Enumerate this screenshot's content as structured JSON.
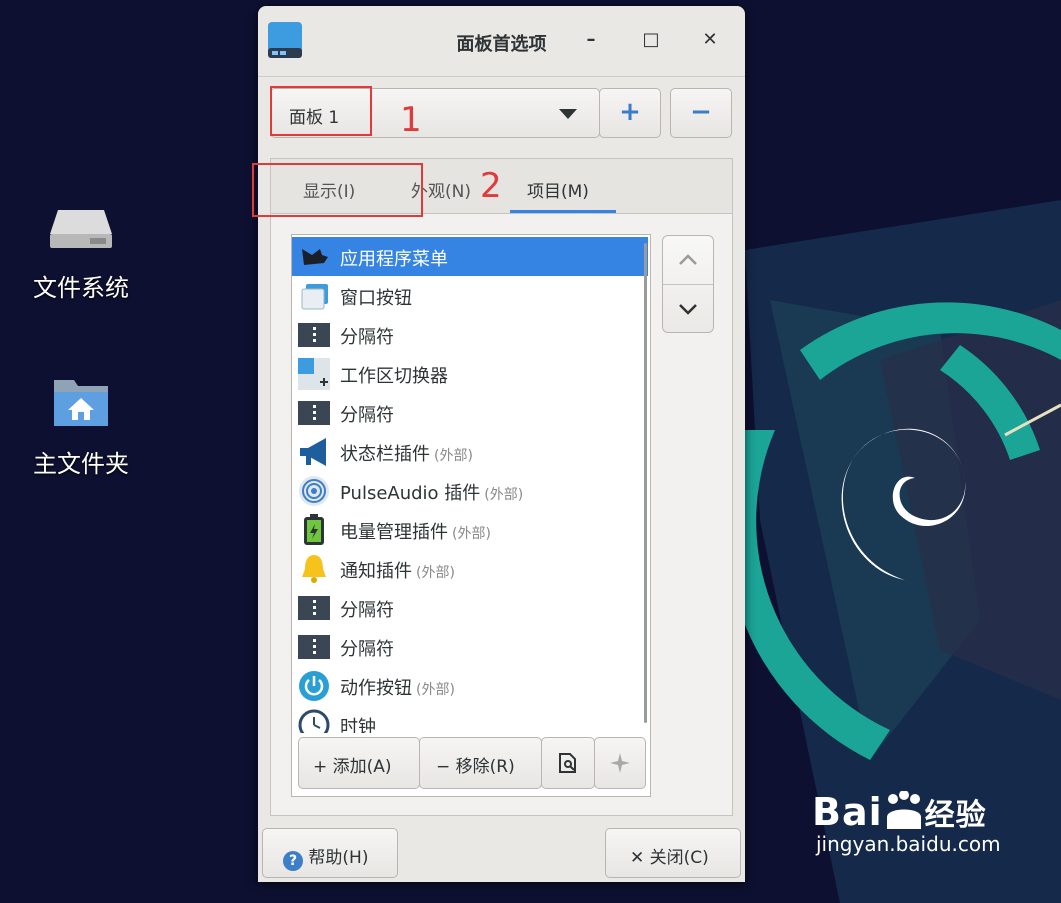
{
  "desktop": {
    "icons": [
      {
        "label": "文件系统",
        "icon": "drive-icon"
      },
      {
        "label": "主文件夹",
        "icon": "home-folder-icon"
      }
    ]
  },
  "window": {
    "title": "面板首选项",
    "minimize": "–",
    "maximize": "□",
    "close": "✕"
  },
  "panel_select": {
    "value": "面板 1",
    "add_symbol": "+",
    "remove_symbol": "−"
  },
  "tabs": [
    {
      "label": "显示(I)",
      "active": false
    },
    {
      "label": "外观(N)",
      "active": false
    },
    {
      "label": "项目(M)",
      "active": true
    }
  ],
  "items": [
    {
      "name": "应用程序菜单",
      "extra": "",
      "icon": "app-menu-icon",
      "selected": true
    },
    {
      "name": "窗口按钮",
      "extra": "",
      "icon": "window-buttons-icon",
      "selected": false
    },
    {
      "name": "分隔符",
      "extra": "",
      "icon": "separator-icon",
      "selected": false
    },
    {
      "name": "工作区切换器",
      "extra": "",
      "icon": "workspace-switcher-icon",
      "selected": false
    },
    {
      "name": "分隔符",
      "extra": "",
      "icon": "separator-icon",
      "selected": false
    },
    {
      "name": "状态栏插件",
      "extra": "(外部)",
      "icon": "megaphone-icon",
      "selected": false
    },
    {
      "name": "PulseAudio 插件",
      "extra": "(外部)",
      "icon": "audio-icon",
      "selected": false
    },
    {
      "name": "电量管理插件",
      "extra": "(外部)",
      "icon": "battery-icon",
      "selected": false
    },
    {
      "name": "通知插件",
      "extra": "(外部)",
      "icon": "bell-icon",
      "selected": false
    },
    {
      "name": "分隔符",
      "extra": "",
      "icon": "separator-icon",
      "selected": false
    },
    {
      "name": "分隔符",
      "extra": "",
      "icon": "separator-icon",
      "selected": false
    },
    {
      "name": "动作按钮",
      "extra": "(外部)",
      "icon": "power-icon",
      "selected": false
    },
    {
      "name": "时钟",
      "extra": "",
      "icon": "clock-icon",
      "selected": false
    }
  ],
  "item_toolbar": {
    "add": "添加(A)",
    "remove": "移除(R)",
    "add_symbol": "+",
    "remove_symbol": "−"
  },
  "footer": {
    "help": "帮助(H)",
    "close": "关闭(C)",
    "close_symbol": "✕"
  },
  "annotations": {
    "num1": "1",
    "num2": "2"
  },
  "watermark": {
    "brand": "Bai",
    "brand2": "du",
    "cn": "经验",
    "url": "jingyan.baidu.com"
  },
  "colors": {
    "accent": "#3584e4",
    "annotation": "#e03a3a",
    "desktop": "#0d1030",
    "teal": "#1aa597"
  }
}
